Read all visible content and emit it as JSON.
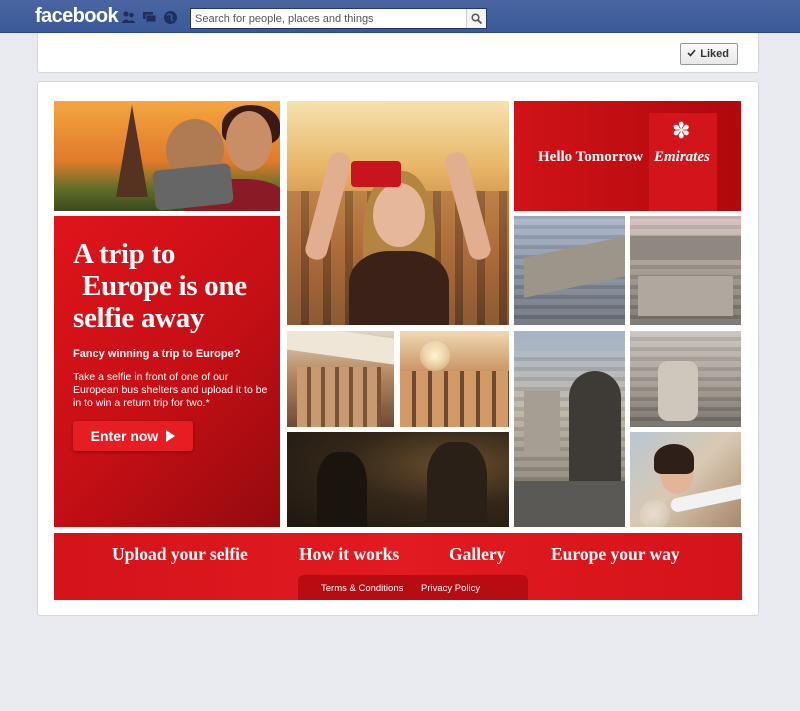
{
  "topbar": {
    "logo": "facebook",
    "search_placeholder": "Search for people, places and things",
    "icons": [
      "friend-requests-icon",
      "messages-icon",
      "notifications-globe-icon"
    ]
  },
  "page_header": {
    "liked_label": "Liked"
  },
  "campaign": {
    "headline_line1": "A trip to",
    "headline_line2": "Europe is one",
    "headline_line3": "selfie away",
    "subheading": "Fancy winning a trip to Europe?",
    "body": "Take a selfie in front of one of our European bus shelters and upload it to be in to win a return trip for two.*",
    "cta_label": "Enter now",
    "brand_tagline": "Hello Tomorrow",
    "brand_name": "Emirates"
  },
  "nav": {
    "items": [
      "Upload your selfie",
      "How it works",
      "Gallery",
      "Europe your way"
    ]
  },
  "footer": {
    "terms": "Terms & Conditions",
    "privacy": "Privacy Policy"
  },
  "colors": {
    "facebook_blue": "#3b5998",
    "emirates_red": "#d4131a"
  }
}
